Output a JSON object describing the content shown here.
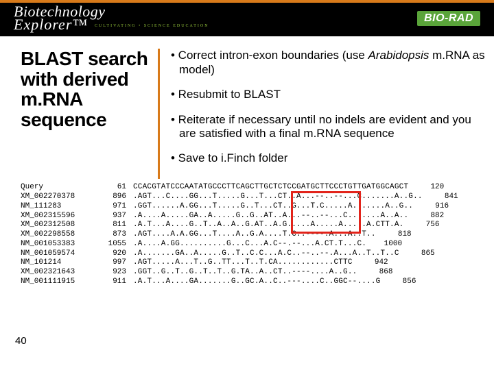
{
  "header": {
    "logo_line1": "Biotechnology",
    "logo_line2": "Explorer",
    "logo_tm": "™",
    "tagline": "CULTIVATING  •  SCIENCE  EDUCATION",
    "brand": "BIO-RAD"
  },
  "title": "BLAST search with derived m.RNA sequence",
  "bullets": [
    {
      "pre": "• Correct intron-exon boundaries (use ",
      "em": "Arabidopsis",
      "post": " m.RNA as model)"
    },
    {
      "pre": "• Resubmit to BLAST",
      "em": "",
      "post": ""
    },
    {
      "pre": "• Reiterate if necessary until no indels are evident and you are satisfied with a final m.RNA sequence",
      "em": "",
      "post": ""
    },
    {
      "pre": "• Save to i.Finch folder",
      "em": "",
      "post": ""
    }
  ],
  "alignment": {
    "rows": [
      {
        "id": "Query",
        "start": "61",
        "seq": "CCACGTATCCCAATATGCCCTTCAGCTTGCTCTCCGATGCTTCCCTGTTGATGGCAGCT",
        "end": "120"
      },
      {
        "id": "XM_002270378",
        "start": "896",
        "seq": ".AGT...C....GG...T.....G...T...CT..A...--..--...C.......A..G..",
        "end": "841"
      },
      {
        "id": "NM_111283",
        "start": "971",
        "seq": ".GGT......A.GG...T.....G..T...CT..G...T.C.....A.......A..G..",
        "end": "916"
      },
      {
        "id": "XM_002315596",
        "start": "937",
        "seq": ".A....A.....GA..A.....G..G..AT..A...--..--...C.......A..A..",
        "end": "882"
      },
      {
        "id": "XM_002312508",
        "start": "811",
        "seq": ".A.T...A....G..T..A..A..G.AT..A.G.....A.....A.....A.CTT.A.",
        "end": "756"
      },
      {
        "id": "XM_002298558",
        "start": "873",
        "seq": ".AGT....A.A.GG...T....A..G.A....T.C..----.A...A..T..",
        "end": "818"
      },
      {
        "id": "NM_001053383",
        "start": "1055",
        "seq": ".A....A.GG..........G...C...A.C--.--...A.CT.T...C.",
        "end": "1000"
      },
      {
        "id": "NM_001059574",
        "start": "920",
        "seq": ".A.......GA..A.....G..T..C.C...A.C..--..--.A...A..T..T..C",
        "end": "865"
      },
      {
        "id": "NM_101214",
        "start": "997",
        "seq": ".AGT.....A...T..G..TT...T..T.CA............CTTC",
        "end": "942"
      },
      {
        "id": "XM_002321643",
        "start": "923",
        "seq": ".GGT..G..T..G..T..T..G.TA..A..CT..----....A..G..",
        "end": "868"
      },
      {
        "id": "NM_001111915",
        "start": "911",
        "seq": ".A.T...A....GA.......G..GC.A..C..---....C..GGC--....G",
        "end": "856"
      }
    ]
  },
  "slide_number": "40"
}
